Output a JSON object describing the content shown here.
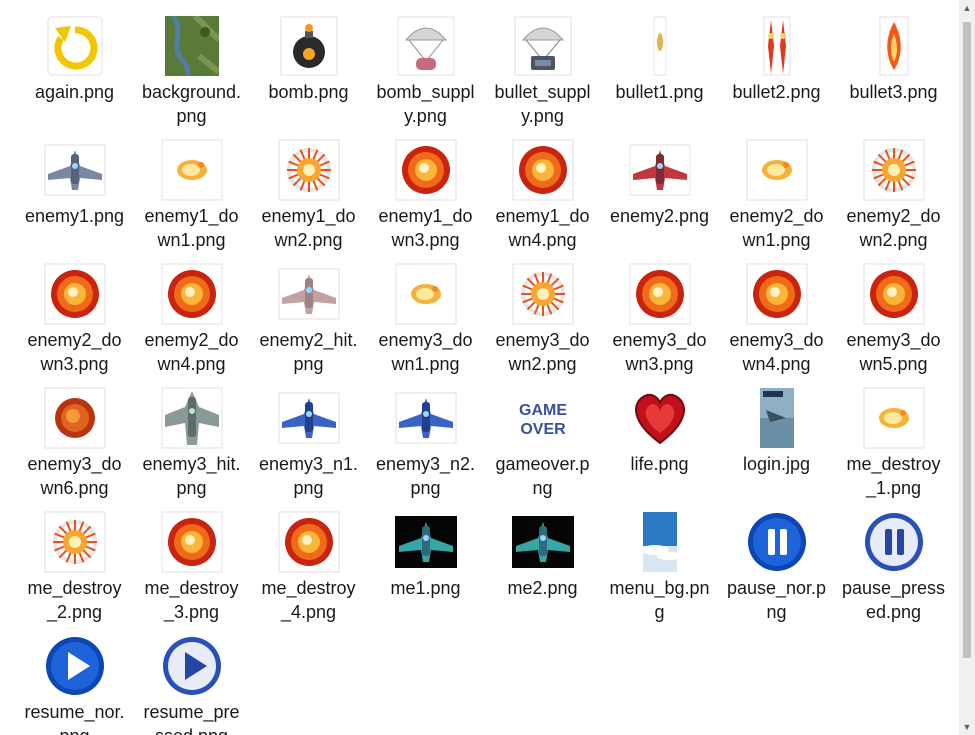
{
  "files": [
    {
      "name": "again.png",
      "icon": "again-icon"
    },
    {
      "name": "background.png",
      "icon": "background-thumbnail-icon"
    },
    {
      "name": "bomb.png",
      "icon": "bomb-icon"
    },
    {
      "name": "bomb_supply.png",
      "icon": "bomb-supply-parachute-icon"
    },
    {
      "name": "bullet_supply.png",
      "icon": "bullet-supply-parachute-icon"
    },
    {
      "name": "bullet1.png",
      "icon": "bullet1-icon"
    },
    {
      "name": "bullet2.png",
      "icon": "bullet2-icon"
    },
    {
      "name": "bullet3.png",
      "icon": "bullet3-icon"
    },
    {
      "name": "enemy1.png",
      "icon": "enemy1-plane-icon"
    },
    {
      "name": "enemy1_down1.png",
      "icon": "explosion-small-icon"
    },
    {
      "name": "enemy1_down2.png",
      "icon": "explosion-burst-icon"
    },
    {
      "name": "enemy1_down3.png",
      "icon": "explosion-large-icon"
    },
    {
      "name": "enemy1_down4.png",
      "icon": "explosion-large-icon"
    },
    {
      "name": "enemy2.png",
      "icon": "enemy2-plane-icon"
    },
    {
      "name": "enemy2_down1.png",
      "icon": "explosion-small-icon"
    },
    {
      "name": "enemy2_down2.png",
      "icon": "explosion-burst-icon"
    },
    {
      "name": "enemy2_down3.png",
      "icon": "explosion-large-icon"
    },
    {
      "name": "enemy2_down4.png",
      "icon": "explosion-large-icon"
    },
    {
      "name": "enemy2_hit.png",
      "icon": "enemy2-hit-plane-icon"
    },
    {
      "name": "enemy3_down1.png",
      "icon": "explosion-small-icon"
    },
    {
      "name": "enemy3_down2.png",
      "icon": "explosion-burst-icon"
    },
    {
      "name": "enemy3_down3.png",
      "icon": "explosion-large-icon"
    },
    {
      "name": "enemy3_down4.png",
      "icon": "explosion-large-icon"
    },
    {
      "name": "enemy3_down5.png",
      "icon": "explosion-large-icon"
    },
    {
      "name": "enemy3_down6.png",
      "icon": "explosion-dark-icon"
    },
    {
      "name": "enemy3_hit.png",
      "icon": "enemy3-hit-plane-icon"
    },
    {
      "name": "enemy3_n1.png",
      "icon": "enemy3-blue-plane-icon"
    },
    {
      "name": "enemy3_n2.png",
      "icon": "enemy3-blue-plane-icon"
    },
    {
      "name": "gameover.png",
      "icon": "gameover-text-icon"
    },
    {
      "name": "life.png",
      "icon": "heart-icon"
    },
    {
      "name": "login.jpg",
      "icon": "login-thumbnail-icon"
    },
    {
      "name": "me_destroy_1.png",
      "icon": "explosion-small-icon"
    },
    {
      "name": "me_destroy_2.png",
      "icon": "explosion-burst-icon"
    },
    {
      "name": "me_destroy_3.png",
      "icon": "explosion-large-icon"
    },
    {
      "name": "me_destroy_4.png",
      "icon": "explosion-large-icon"
    },
    {
      "name": "me1.png",
      "icon": "player-plane-icon"
    },
    {
      "name": "me2.png",
      "icon": "player-plane-icon"
    },
    {
      "name": "menu_bg.png",
      "icon": "sky-thumbnail-icon"
    },
    {
      "name": "pause_nor.png",
      "icon": "pause-icon"
    },
    {
      "name": "pause_pressed.png",
      "icon": "pause-pressed-icon"
    },
    {
      "name": "resume_nor.png",
      "icon": "resume-icon"
    },
    {
      "name": "resume_pressed.png",
      "icon": "resume-pressed-icon"
    }
  ],
  "gameover_text": [
    "GAME",
    "OVER"
  ]
}
